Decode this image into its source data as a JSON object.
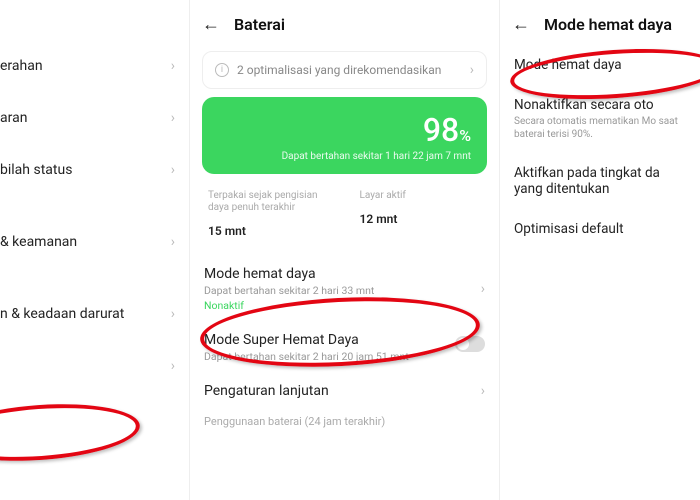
{
  "panel1": {
    "items": [
      "erahan",
      "aran",
      "bilah status",
      "& keamanan",
      "n & keadaan darurat",
      ""
    ]
  },
  "panel2": {
    "title": "Baterai",
    "opt_text": "2 optimalisasi yang direkomendasikan",
    "battery": {
      "percent": "98",
      "unit": "%",
      "estimate": "Dapat bertahan sekitar 1 hari 22 jam 7 mnt"
    },
    "stat1_label": "Terpakai sejak pengisian daya penuh terakhir",
    "stat1_value": "15 mnt",
    "stat2_label": "Layar aktif",
    "stat2_value": "12 mnt",
    "mode_saver": {
      "title": "Mode hemat daya",
      "sub": "Dapat bertahan sekitar 2 hari 33 mnt",
      "status": "Nonaktif"
    },
    "mode_super": {
      "title": "Mode Super Hemat Daya",
      "sub": "Dapat bertahan sekitar 2 hari 20 jam 51 mnt"
    },
    "advanced": "Pengaturan lanjutan",
    "footer": "Penggunaan baterai (24 jam terakhir)"
  },
  "panel3": {
    "title": "Mode hemat daya",
    "row1": "Mode hemat daya",
    "row2_t": "Nonaktifkan secara oto",
    "row2_sub": "Secara otomatis mematikan Mo saat baterai terisi 90%.",
    "row3": "Aktifkan pada tingkat da yang ditentukan",
    "row4": "Optimisasi default"
  }
}
